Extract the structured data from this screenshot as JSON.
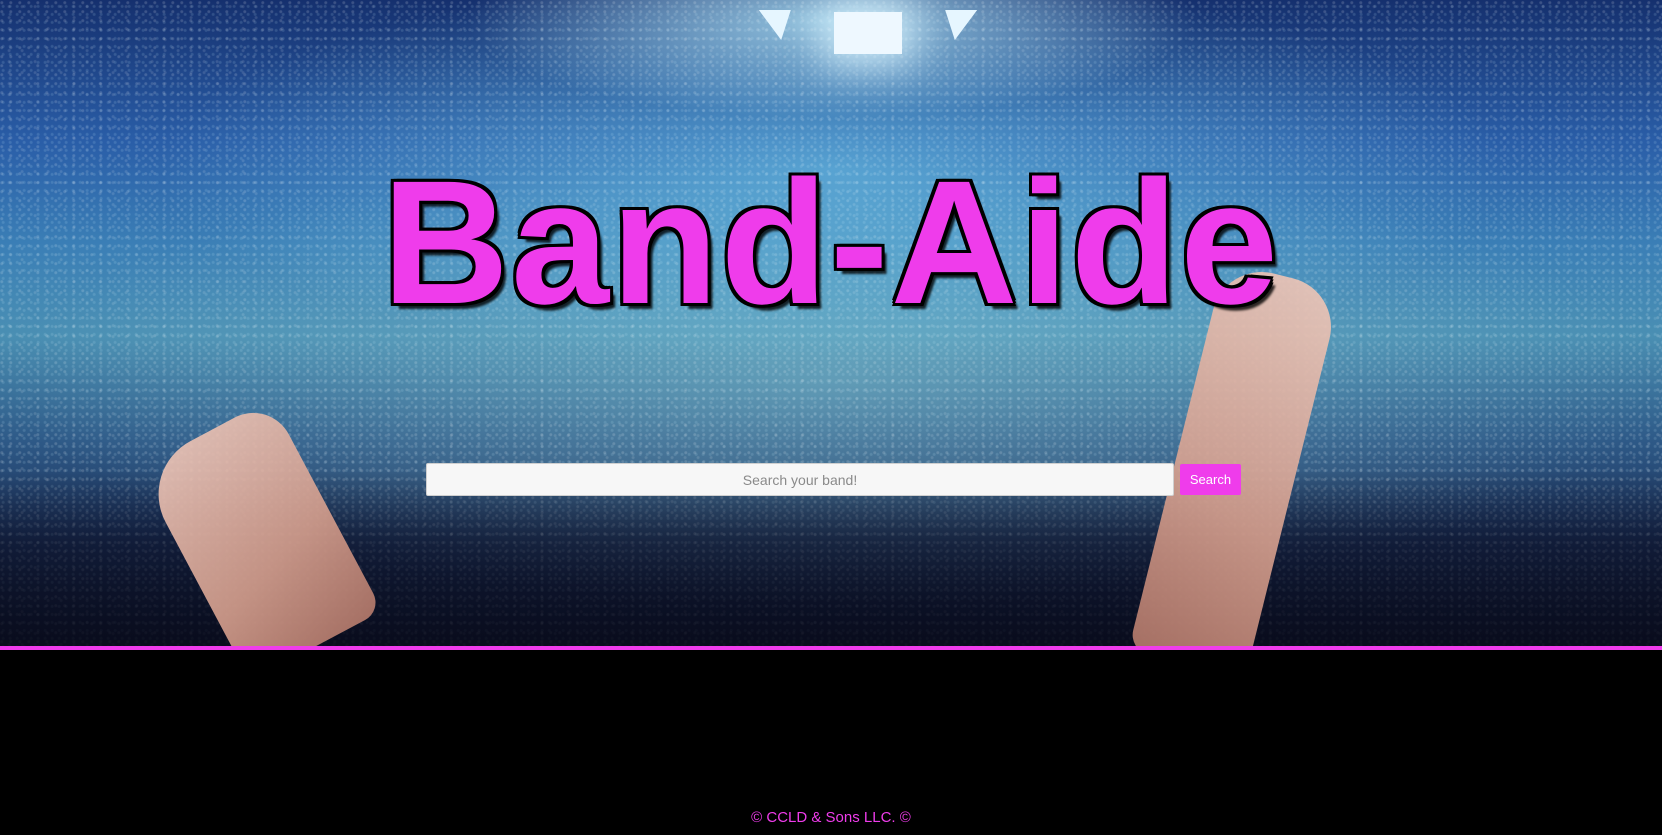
{
  "hero": {
    "title": "Band-Aide"
  },
  "search": {
    "placeholder": "Search your band!",
    "value": "",
    "button_label": "Search"
  },
  "footer": {
    "copyright": "© CCLD & Sons LLC. ©"
  },
  "colors": {
    "accent": "#ef3ceb",
    "footer_background": "#000000",
    "input_background": "#f7f7f7"
  }
}
